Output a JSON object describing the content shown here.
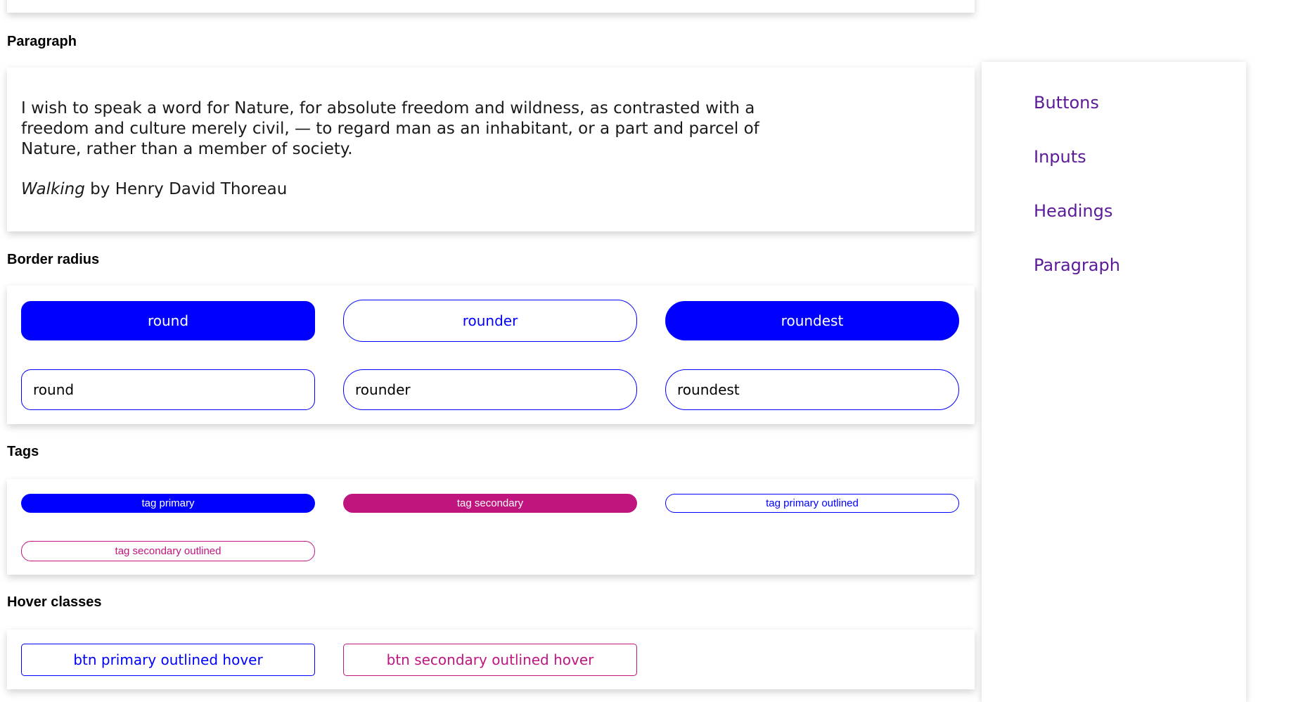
{
  "sections": {
    "paragraph": {
      "title": "Paragraph",
      "quote": "I wish to speak a word for Nature, for absolute freedom and wildness, as contrasted with a freedom and culture merely civil, — to regard man as an inhabitant, or a part and parcel of Nature, rather than a member of society.",
      "cite_work": "Walking",
      "cite_author": " by Henry David Thoreau"
    },
    "border_radius": {
      "title": "Border radius",
      "buttons": [
        "round",
        "rounder",
        "roundest"
      ],
      "inputs": [
        "round",
        "rounder",
        "roundest"
      ]
    },
    "tags": {
      "title": "Tags",
      "items": [
        "tag primary",
        "tag secondary",
        "tag primary outlined",
        "tag secondary outlined"
      ]
    },
    "hover": {
      "title": "Hover classes",
      "buttons": [
        "btn primary outlined hover",
        "btn secondary outlined hover"
      ]
    }
  },
  "sidebar": {
    "items": [
      {
        "label": "Buttons"
      },
      {
        "label": "Inputs"
      },
      {
        "label": "Headings"
      },
      {
        "label": "Paragraph"
      }
    ]
  },
  "colors": {
    "primary": "#0000ff",
    "secondary": "#c0157e",
    "nav_link": "#5b1a9a"
  }
}
